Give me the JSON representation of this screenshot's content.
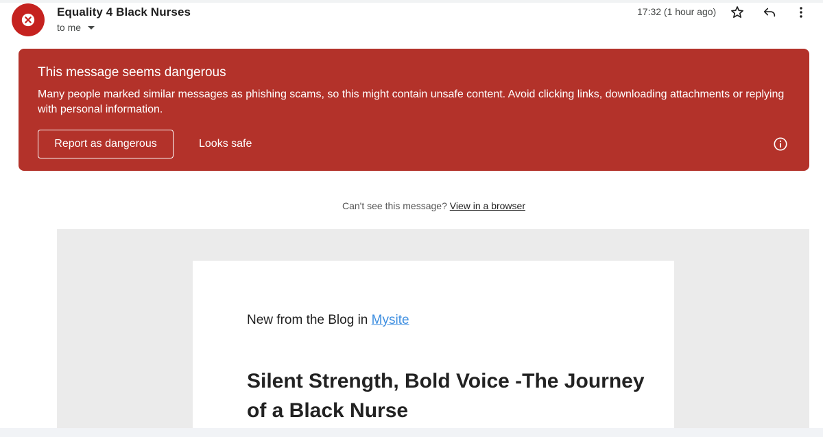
{
  "header": {
    "sender": "Equality 4 Black Nurses",
    "recipient": "to me",
    "timestamp": "17:32 (1 hour ago)"
  },
  "icons": {
    "avatar": "blocked-x-icon",
    "star": "star-icon",
    "reply": "reply-icon",
    "more": "more-vert-icon",
    "info": "info-icon"
  },
  "colors": {
    "banner": "#b3322a",
    "avatar": "#c5221f",
    "link": "#3d8ee0"
  },
  "banner": {
    "title": "This message seems dangerous",
    "body": "Many people marked similar messages as phishing scams, so this might contain unsafe content. Avoid clicking links, downloading attachments or replying with personal information.",
    "report_label": "Report as dangerous",
    "safe_label": "Looks safe"
  },
  "email": {
    "cant_see_text": "Can't see this message?",
    "view_browser_link": "View in a browser",
    "blog_prefix": "New from the Blog in",
    "blog_link": "Mysite",
    "post_title": "Silent Strength, Bold Voice -The Journey of a Black Nurse"
  }
}
